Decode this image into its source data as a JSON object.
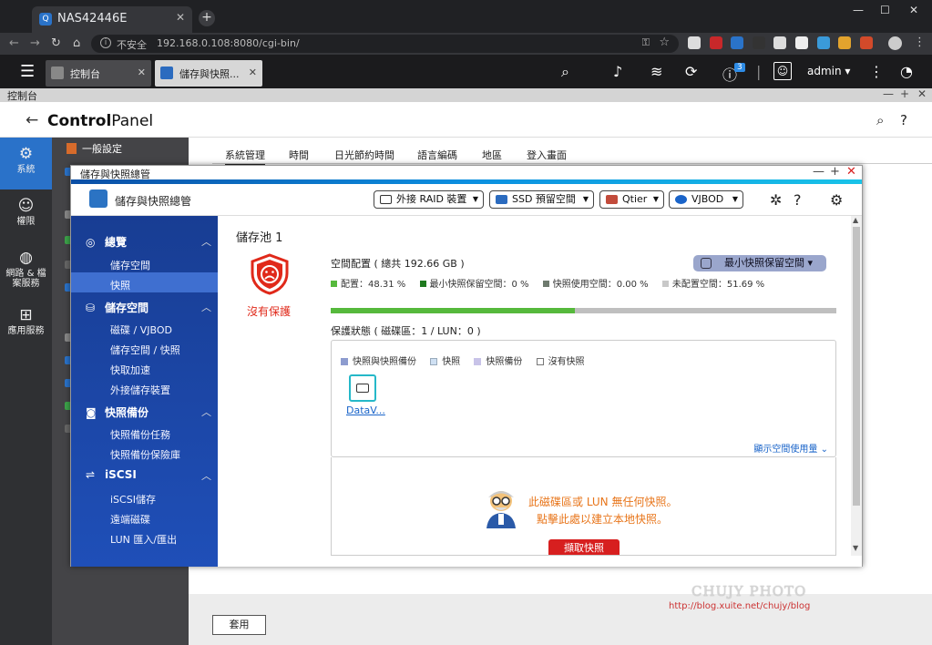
{
  "browser": {
    "tab_title": "NAS42446E",
    "not_secure": "不安全",
    "url": "192.168.0.108:8080/cgi-bin/",
    "user": "admin"
  },
  "qts": {
    "tabs": [
      {
        "label": "控制台"
      },
      {
        "label": "儲存與快照..."
      }
    ],
    "notif_count": "3",
    "user": "admin"
  },
  "control_bar": {
    "title": "控制台"
  },
  "control_panel": {
    "title_a": "Control",
    "title_b": "Panel",
    "rail": [
      {
        "label": "系統"
      },
      {
        "label": "權限"
      },
      {
        "label": "網路 & 檔\n案服務"
      },
      {
        "label": "應用服務"
      }
    ],
    "list_first": "一般設定",
    "tabs": [
      "系統管理",
      "時間",
      "日光節約時間",
      "語言編碼",
      "地區",
      "登入畫面"
    ],
    "apply": "套用"
  },
  "storage_window": {
    "title": "儲存與快照總管",
    "app_title": "儲存與快照總管",
    "toolbar": {
      "ext_raid": "外接 RAID 裝置",
      "ssd": "SSD 預留空間",
      "qtier": "Qtier",
      "vjbod": "VJBOD"
    },
    "sidebar": {
      "sections": [
        {
          "label": "總覽",
          "items": [
            "儲存空間",
            "快照"
          ]
        },
        {
          "label": "儲存空間",
          "items": [
            "磁碟 / VJBOD",
            "儲存空間 / 快照",
            "快取加速",
            "外接儲存裝置"
          ]
        },
        {
          "label": "快照備份",
          "items": [
            "快照備份任務",
            "快照備份保險庫"
          ]
        },
        {
          "label": "iSCSI",
          "items": [
            "iSCSI儲存",
            "遠端磁碟",
            "LUN 匯入/匯出"
          ]
        }
      ],
      "selected": "快照"
    },
    "main": {
      "pool_title": "儲存池 1",
      "no_protection": "沒有保護",
      "allocation": "空間配置 ( 總共 192.66 GB )",
      "legend": [
        {
          "label": "配置：48.31 %",
          "color": "#56b93c"
        },
        {
          "label": "最小快照保留空間：0 %",
          "color": "#1f7a1f"
        },
        {
          "label": "快照使用空間：0.00 %",
          "color": "#6e7a6e"
        },
        {
          "label": "未配置空間：51.69 %",
          "color": "#c8c8c8"
        }
      ],
      "min_snapshot_btn": "最小快照保留空間",
      "allocated_pct": 48.31,
      "protection_status": "保護狀態 ( 磁碟區：1 / LUN：0 )",
      "prot_legend": [
        {
          "label": "快照與快照備份",
          "color": "#8d9ccf"
        },
        {
          "label": "快照",
          "color": "#cfe0f3"
        },
        {
          "label": "快照備份",
          "color": "#c8c3e8"
        },
        {
          "label": "沒有快照",
          "color": "#ffffff"
        }
      ],
      "volume_name": "DataV...",
      "show_usage": "顯示空間使用量",
      "empty_line1": "此磁碟區或 LUN 無任何快照。",
      "empty_line2": "點擊此處以建立本地快照。",
      "take_snapshot": "擷取快照"
    }
  },
  "watermark": {
    "line1": "CHUJY PHOTO",
    "line2": "http://blog.xuite.net/chujy/blog"
  }
}
